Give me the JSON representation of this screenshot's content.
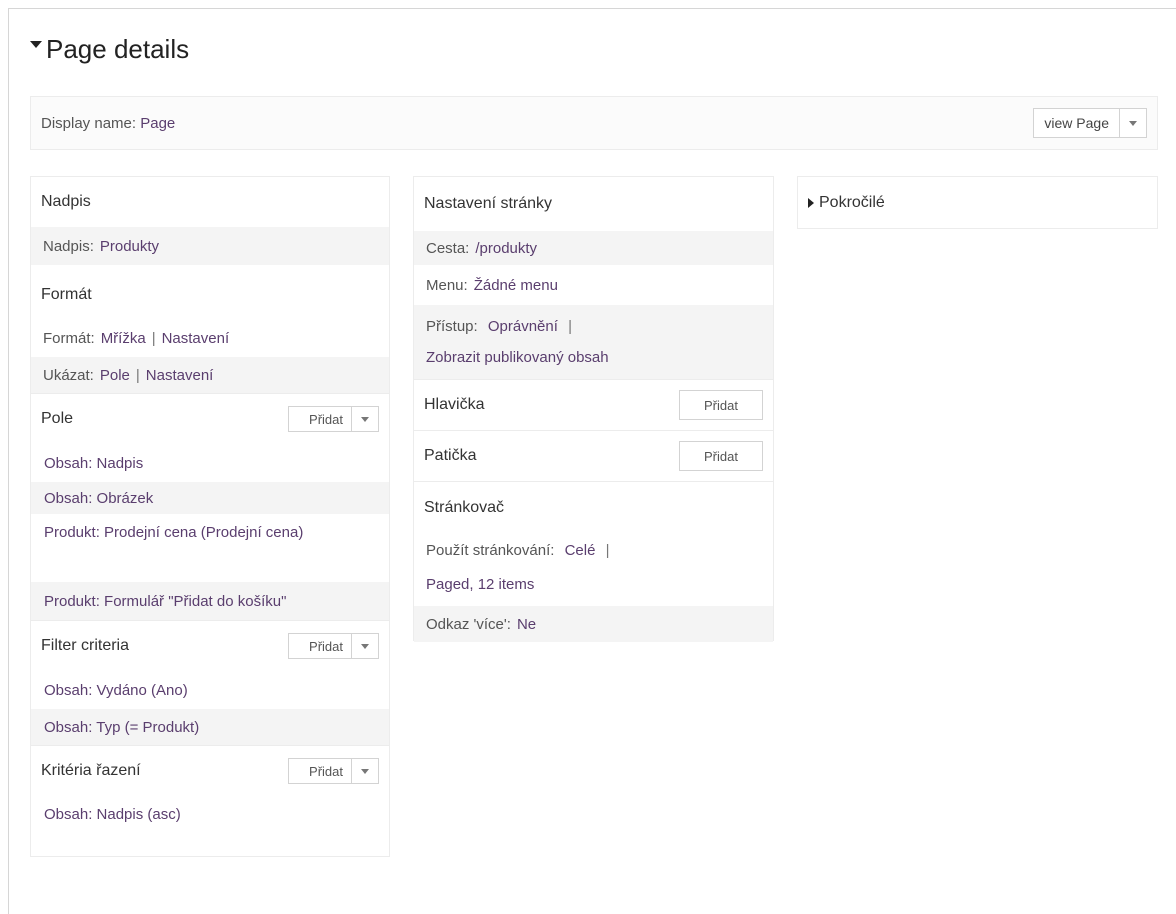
{
  "page": {
    "title": "Page details"
  },
  "display": {
    "label": "Display name:",
    "value": "Page",
    "view_button": "view Page"
  },
  "column1": {
    "nadpis": {
      "title": "Nadpis",
      "label": "Nadpis:",
      "value": "Produkty"
    },
    "format": {
      "title": "Formát",
      "format_label": "Formát:",
      "format_value": "Mřížka",
      "format_settings": "Nastavení",
      "show_label": "Ukázat:",
      "show_value": "Pole",
      "show_settings": "Nastavení"
    },
    "pole": {
      "title": "Pole",
      "add": "Přidat",
      "items": [
        "Obsah: Nadpis",
        "Obsah: Obrázek",
        "Produkt: Prodejní cena (Prodejní cena)",
        "Produkt: Formulář \"Přidat do košíku\""
      ]
    },
    "filter": {
      "title": "Filter criteria",
      "add": "Přidat",
      "items": [
        "Obsah: Vydáno (Ano)",
        "Obsah: Typ (= Produkt)"
      ]
    },
    "sort": {
      "title": "Kritéria řazení",
      "add": "Přidat",
      "items": [
        "Obsah: Nadpis (asc)"
      ]
    }
  },
  "column2": {
    "settings": {
      "title": "Nastavení stránky",
      "path_label": "Cesta:",
      "path_value": "/produkty",
      "menu_label": "Menu:",
      "menu_value": "Žádné menu",
      "access_label": "Přístup:",
      "access_value": "Oprávnění",
      "access_detail": "Zobrazit publikovaný obsah"
    },
    "header": {
      "title": "Hlavička",
      "add": "Přidat"
    },
    "footer": {
      "title": "Patička",
      "add": "Přidat"
    },
    "pager": {
      "title": "Stránkovač",
      "use_label": "Použít stránkování:",
      "use_value": "Celé",
      "use_detail": "Paged, 12 items",
      "more_label": "Odkaz 'více':",
      "more_value": "Ne"
    }
  },
  "column3": {
    "advanced": "Pokročilé"
  },
  "separator": "|"
}
